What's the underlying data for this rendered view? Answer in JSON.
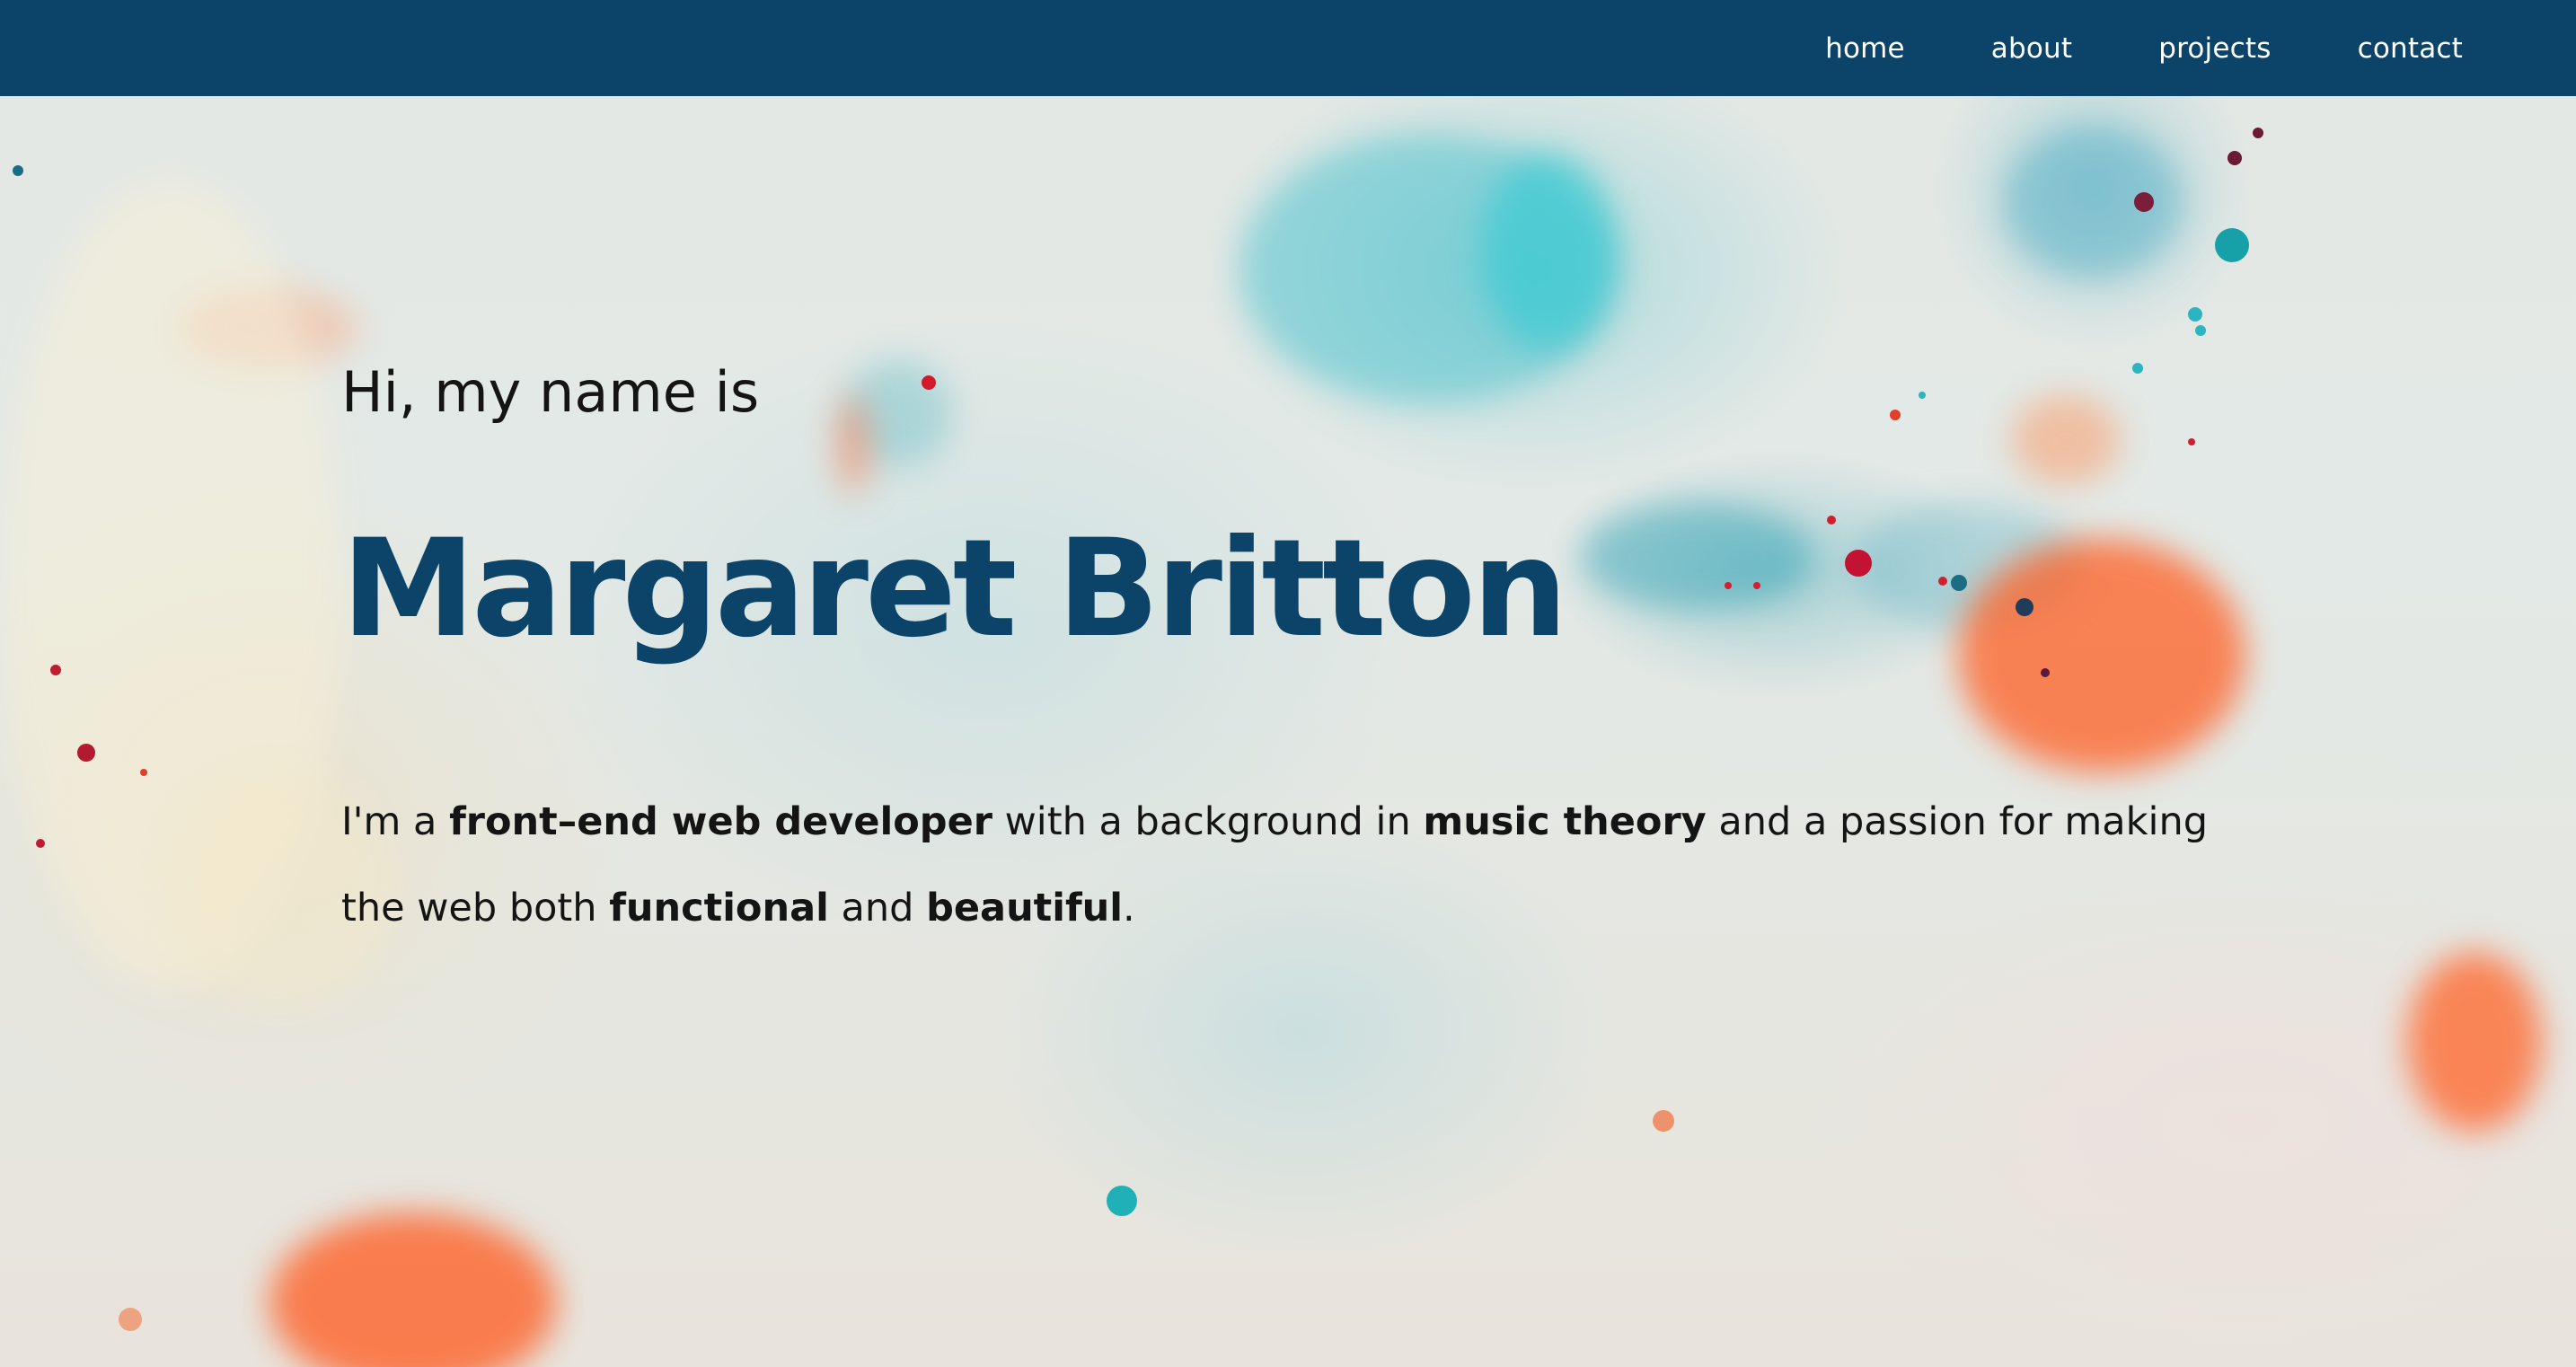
{
  "nav": {
    "items": [
      {
        "label": "home"
      },
      {
        "label": "about"
      },
      {
        "label": "projects"
      },
      {
        "label": "contact"
      }
    ]
  },
  "hero": {
    "greeting": "Hi, my name is",
    "name": "Margaret Britton",
    "bio": {
      "part1": "I'm a ",
      "highlight1": "front–end web developer",
      "part2": " with a background in ",
      "highlight2": "music theory",
      "part3": " and a passion for making the web both ",
      "highlight3": "functional",
      "part4": " and ",
      "highlight4": "beautiful",
      "part5": "."
    }
  },
  "colors": {
    "nav_background": "#0b4468",
    "name_color": "#0b4468",
    "text_color": "#141414",
    "accent_orange": "#ff5a1f",
    "accent_teal": "#2bb5c4"
  }
}
